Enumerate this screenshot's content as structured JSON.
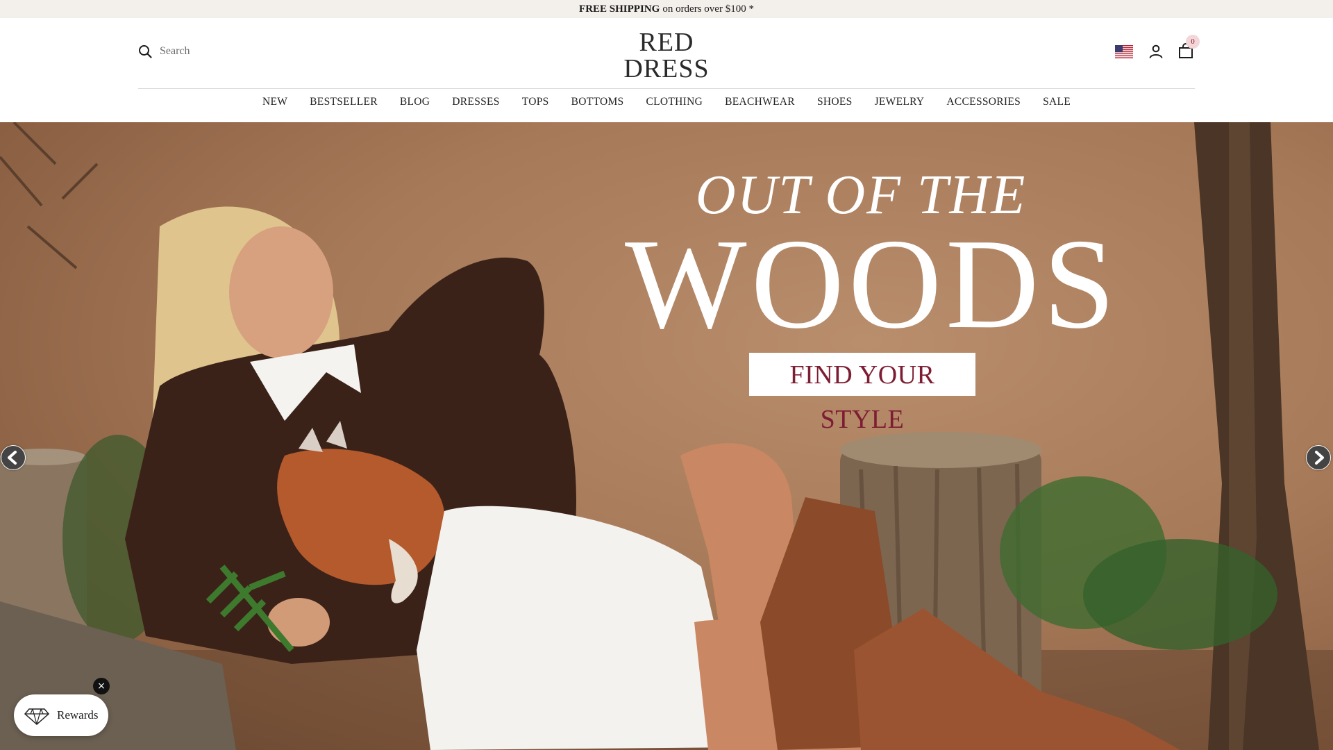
{
  "announcement": {
    "bold": "FREE SHIPPING",
    "rest": "on orders over $100 *"
  },
  "header": {
    "search_placeholder": "Search",
    "logo_line1": "RED",
    "logo_line2": "DRESS",
    "cart_count": "0",
    "icons": [
      "search-icon",
      "us-flag-icon",
      "account-icon",
      "cart-icon"
    ]
  },
  "nav": [
    {
      "label": "NEW"
    },
    {
      "label": "BESTSELLER"
    },
    {
      "label": "BLOG"
    },
    {
      "label": "DRESSES"
    },
    {
      "label": "TOPS"
    },
    {
      "label": "BOTTOMS"
    },
    {
      "label": "CLOTHING"
    },
    {
      "label": "BEACHWEAR"
    },
    {
      "label": "SHOES"
    },
    {
      "label": "JEWELRY"
    },
    {
      "label": "ACCESSORIES"
    },
    {
      "label": "SALE"
    }
  ],
  "hero": {
    "line1": "OUT OF THE",
    "line2": "WOODS",
    "cta": "FIND YOUR STYLE"
  },
  "rewards": {
    "label": "Rewards",
    "close": "×"
  },
  "colors": {
    "announcement_bg": "#f3efeb",
    "cta_text": "#7d1d33",
    "hero_bg": "#a67958",
    "cart_badge": "#f4d6d9"
  }
}
